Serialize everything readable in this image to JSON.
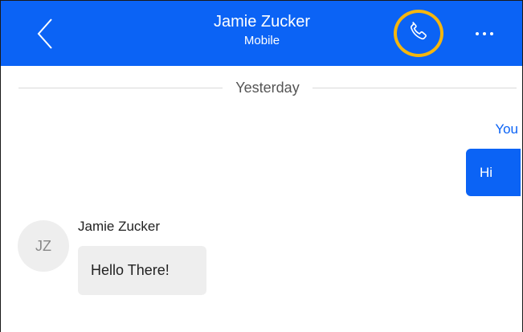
{
  "header": {
    "contact_name": "Jamie Zucker",
    "contact_subtitle": "Mobile",
    "back_icon": "chevron-left-icon",
    "call_icon": "phone-icon",
    "more_icon": "more-dots-icon"
  },
  "conversation": {
    "date_divider": "Yesterday",
    "messages": [
      {
        "direction": "outgoing",
        "sender_label": "You",
        "text": "Hi"
      },
      {
        "direction": "incoming",
        "sender_label": "Jamie Zucker",
        "avatar_initials": "JZ",
        "text": "Hello There!"
      }
    ]
  },
  "colors": {
    "header_blue": "#0b63f5",
    "highlight_ring": "#f5b60e",
    "incoming_bubble": "#eeeeee",
    "outgoing_bubble": "#0b63f5"
  }
}
